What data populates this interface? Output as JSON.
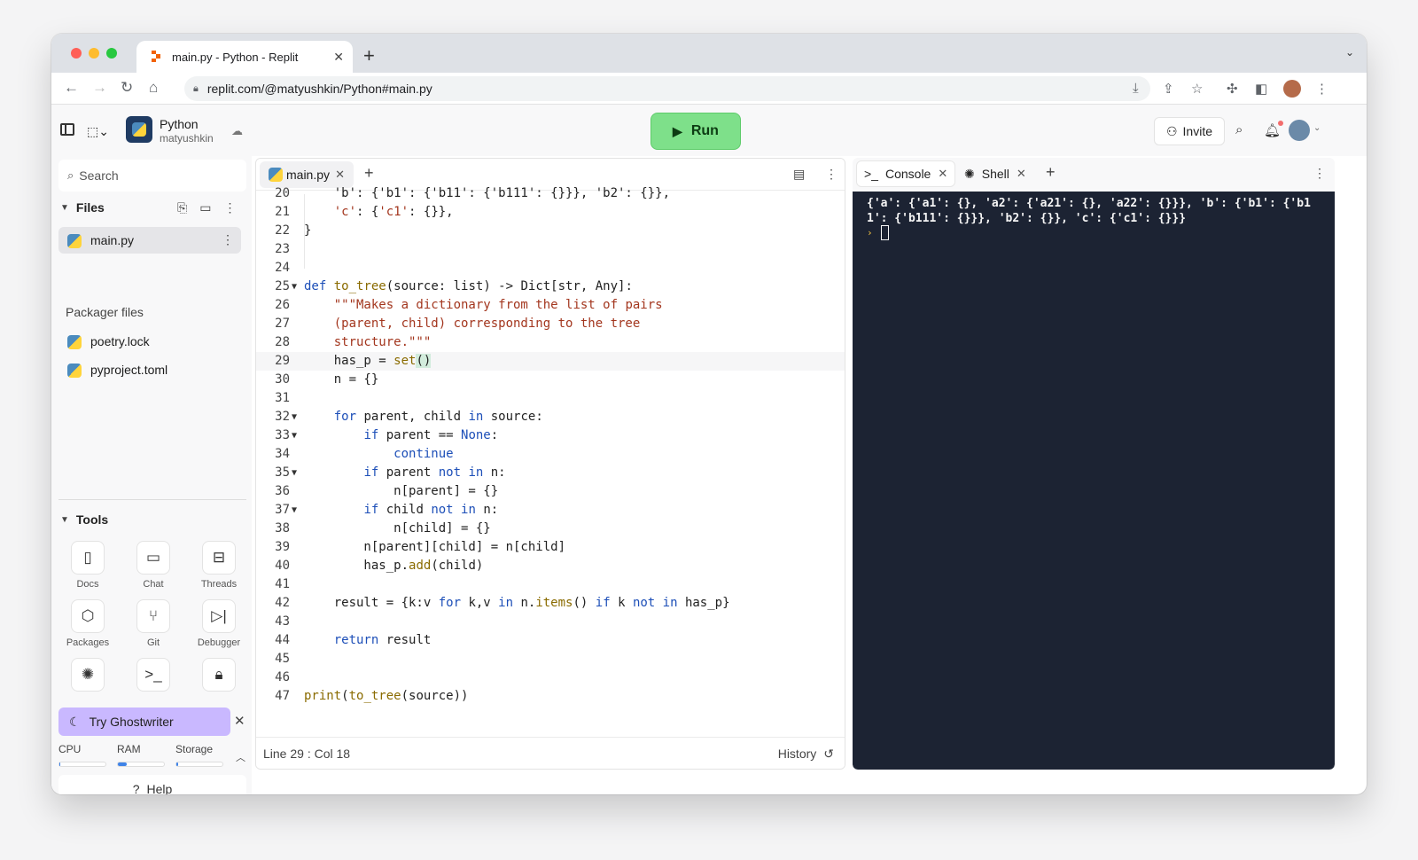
{
  "browser": {
    "tab_title": "main.py - Python - Replit",
    "url": "replit.com/@matyushkin/Python#main.py"
  },
  "header": {
    "repl_name": "Python",
    "owner": "matyushkin",
    "run_label": "Run",
    "invite_label": "Invite"
  },
  "sidebar": {
    "search_placeholder": "Search",
    "files_title": "Files",
    "files": [
      {
        "name": "main.py"
      }
    ],
    "packager_title": "Packager files",
    "packager_files": [
      {
        "name": "poetry.lock"
      },
      {
        "name": "pyproject.toml"
      }
    ],
    "tools_title": "Tools",
    "tools": [
      {
        "label": "Docs",
        "icon": "docs-icon"
      },
      {
        "label": "Chat",
        "icon": "chat-icon"
      },
      {
        "label": "Threads",
        "icon": "threads-icon"
      },
      {
        "label": "Packages",
        "icon": "packages-icon"
      },
      {
        "label": "Git",
        "icon": "git-icon"
      },
      {
        "label": "Debugger",
        "icon": "debugger-icon"
      }
    ],
    "ghostwriter_label": "Try Ghostwriter",
    "resources": {
      "cpu_label": "CPU",
      "ram_label": "RAM",
      "storage_label": "Storage",
      "cpu": 0.02,
      "ram": 0.2,
      "storage": 0.03
    },
    "help_label": "Help"
  },
  "editor": {
    "tab_label": "main.py",
    "status": "Line 29 : Col 18",
    "history_label": "History"
  },
  "console": {
    "tabs": [
      {
        "label": "Console"
      },
      {
        "label": "Shell"
      }
    ],
    "output": "{'a': {'a1': {}, 'a2': {'a21': {}, 'a22': {}}}, 'b': {'b1': {'b11': {'b111': {}}}, 'b2': {}}, 'c': {'c1': {}}}"
  },
  "colors": {
    "run_button": "#7ee08a",
    "terminal_bg": "#1c2333",
    "ghostwriter": "#c9b8ff",
    "accent": "#3f83e8"
  }
}
